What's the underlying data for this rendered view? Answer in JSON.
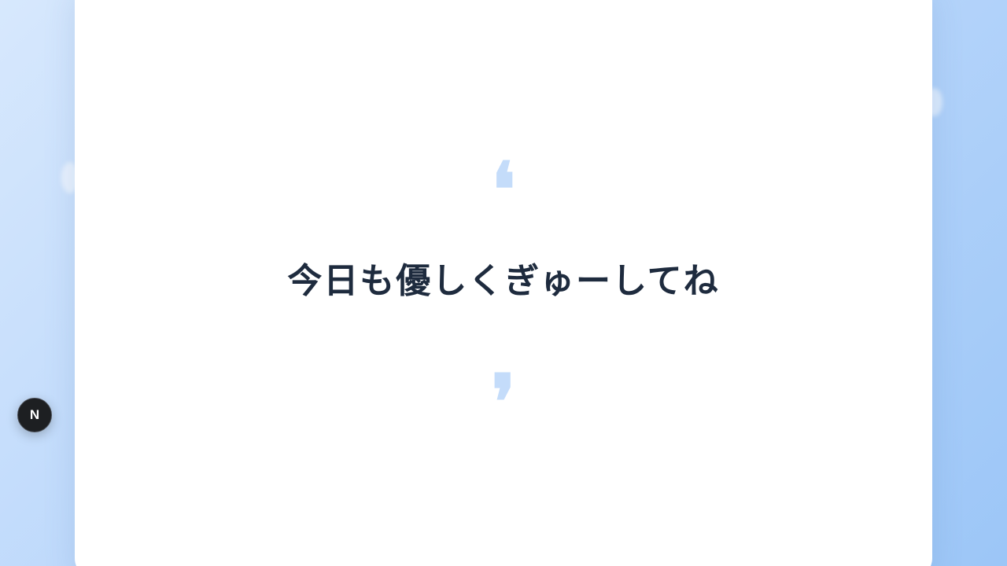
{
  "quote": {
    "open_mark": "❛",
    "close_mark": "❜",
    "message": "今日も優しくぎゅーしてね"
  },
  "dev_badge": {
    "label": "N",
    "icon": "nextjs-logo-icon"
  },
  "colors": {
    "background_start": "#d7e8fd",
    "background_end": "#9cc6f7",
    "card": "#ffffff",
    "quote_marks": "#c4dcfa",
    "text": "#1e2b3e",
    "badge": "#1d1f22"
  }
}
